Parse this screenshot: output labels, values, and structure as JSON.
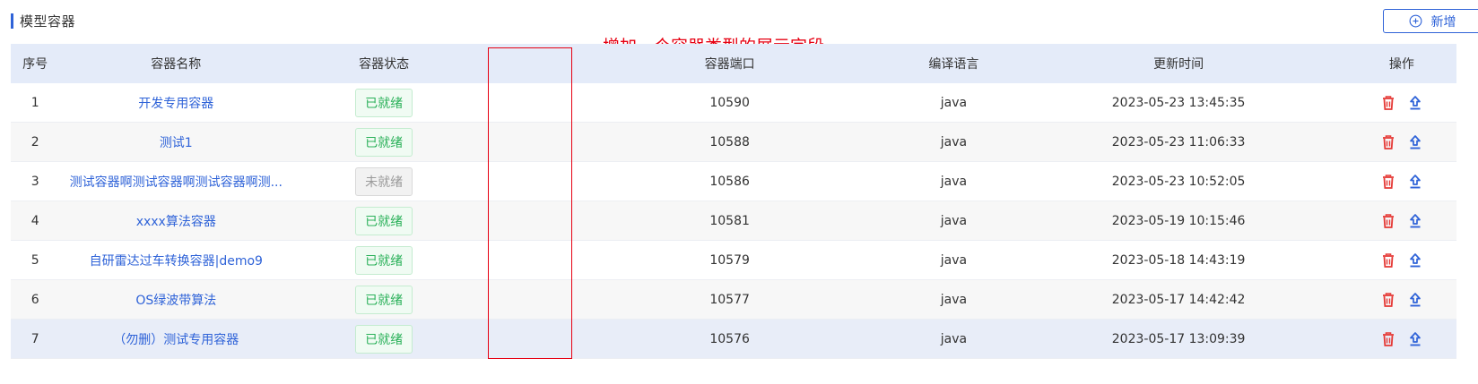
{
  "page": {
    "title": "模型容器",
    "add_button_label": "新增",
    "annotation": "增加一个容器类型的展示字段"
  },
  "colors": {
    "accent": "#2f63d8",
    "ready": "#2bb15a",
    "not_ready": "#9a9a9a",
    "annotation": "#e60012",
    "delete_icon": "#e53935"
  },
  "icons": {
    "add": "plus-circle-icon",
    "delete": "trash-icon",
    "publish": "upload-icon"
  },
  "table": {
    "columns": [
      "序号",
      "容器名称",
      "容器状态",
      "",
      "容器端口",
      "编译语言",
      "更新时间",
      "操作"
    ],
    "rows": [
      {
        "idx": "1",
        "name": "开发专用容器",
        "status": "已就绪",
        "ready": true,
        "port": "10590",
        "lang": "java",
        "updated": "2023-05-23 13:45:35"
      },
      {
        "idx": "2",
        "name": "测试1",
        "status": "已就绪",
        "ready": true,
        "port": "10588",
        "lang": "java",
        "updated": "2023-05-23 11:06:33"
      },
      {
        "idx": "3",
        "name": "测试容器啊测试容器啊测试容器啊测...",
        "status": "未就绪",
        "ready": false,
        "port": "10586",
        "lang": "java",
        "updated": "2023-05-23 10:52:05"
      },
      {
        "idx": "4",
        "name": "xxxx算法容器",
        "status": "已就绪",
        "ready": true,
        "port": "10581",
        "lang": "java",
        "updated": "2023-05-19 10:15:46"
      },
      {
        "idx": "5",
        "name": "自研雷达过车转换容器|demo9",
        "status": "已就绪",
        "ready": true,
        "port": "10579",
        "lang": "java",
        "updated": "2023-05-18 14:43:19"
      },
      {
        "idx": "6",
        "name": "OS绿波带算法",
        "status": "已就绪",
        "ready": true,
        "port": "10577",
        "lang": "java",
        "updated": "2023-05-17 14:42:42"
      },
      {
        "idx": "7",
        "name": "（勿删）测试专用容器",
        "status": "已就绪",
        "ready": true,
        "port": "10576",
        "lang": "java",
        "updated": "2023-05-17 13:09:39"
      }
    ]
  }
}
